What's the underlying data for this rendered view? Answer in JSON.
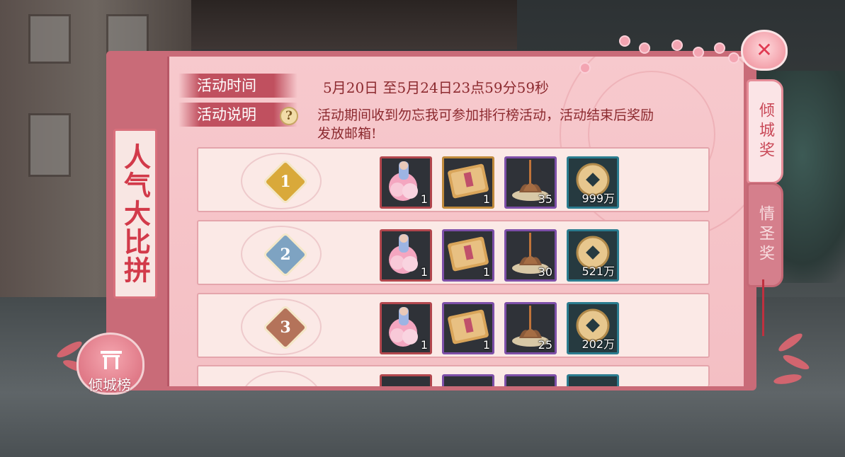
{
  "title": "人气大比拼",
  "ranking_button": {
    "label": "倾城榜",
    "icon": "gate-icon"
  },
  "info": {
    "time_label": "活动时间",
    "time_value": "5月20日 至5月24日23点59分59秒",
    "desc_label": "活动说明",
    "desc_value_line1": "活动期间收到勿忘我可参加排行榜活动，活动结束后奖励",
    "desc_value_line2": "发放邮箱!",
    "help_icon": "question-icon"
  },
  "tabs": [
    {
      "label": "倾城奖",
      "active": true
    },
    {
      "label": "情圣奖",
      "active": false
    }
  ],
  "close_icon": "close-icon",
  "rewards": [
    {
      "rank": "1",
      "rank_color": "#d9a93a",
      "items": [
        {
          "icon": "lotus-fairy-icon",
          "count": "1",
          "frame": "red"
        },
        {
          "icon": "scroll-icon",
          "count": "1",
          "frame": "gold"
        },
        {
          "icon": "incense-lotus-icon",
          "count": "35",
          "frame": "purple"
        },
        {
          "icon": "coin-icon",
          "count": "999万",
          "frame": "teal"
        }
      ]
    },
    {
      "rank": "2",
      "rank_color": "#7ea3c2",
      "items": [
        {
          "icon": "lotus-fairy-icon",
          "count": "1",
          "frame": "red"
        },
        {
          "icon": "scroll-icon",
          "count": "1",
          "frame": "purple"
        },
        {
          "icon": "incense-lotus-icon",
          "count": "30",
          "frame": "purple"
        },
        {
          "icon": "coin-icon",
          "count": "521万",
          "frame": "teal"
        }
      ]
    },
    {
      "rank": "3",
      "rank_color": "#b4735a",
      "items": [
        {
          "icon": "lotus-fairy-icon",
          "count": "1",
          "frame": "red"
        },
        {
          "icon": "scroll-icon",
          "count": "1",
          "frame": "purple"
        },
        {
          "icon": "incense-lotus-icon",
          "count": "25",
          "frame": "purple"
        },
        {
          "icon": "coin-icon",
          "count": "202万",
          "frame": "teal"
        }
      ]
    }
  ]
}
